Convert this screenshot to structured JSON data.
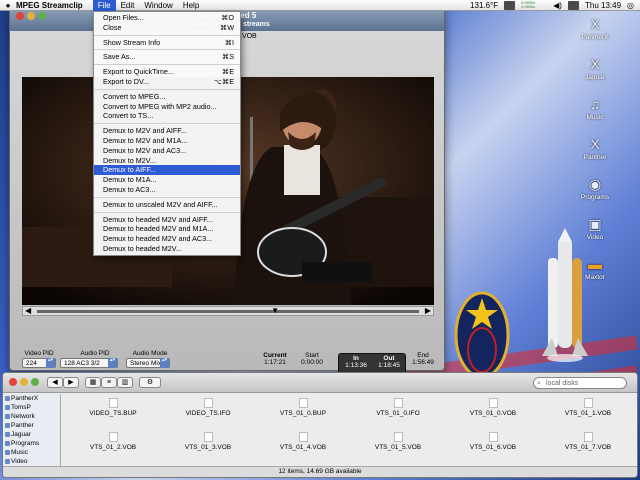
{
  "menubar": {
    "app": "MPEG Streamclip",
    "menus": [
      "File",
      "Edit",
      "Window",
      "Help"
    ],
    "temperature": "131.6°F",
    "net_up": "0.0KB/s",
    "net_down": "0.0KB/s",
    "clock": "Thu 13:49"
  },
  "file_menu": {
    "items": [
      {
        "label": "Open Files...",
        "shortcut": "⌘O"
      },
      {
        "label": "Close",
        "shortcut": "⌘W"
      },
      {
        "sep": true
      },
      {
        "label": "Show Stream Info",
        "shortcut": "⌘I"
      },
      {
        "sep": true
      },
      {
        "label": "Save As...",
        "shortcut": "⌘S"
      },
      {
        "sep": true
      },
      {
        "label": "Export to QuickTime...",
        "shortcut": "⌘E"
      },
      {
        "label": "Export to DV...",
        "shortcut": "⌥⌘E"
      },
      {
        "sep": true
      },
      {
        "label": "Convert to MPEG..."
      },
      {
        "label": "Convert to MPEG with MP2 audio..."
      },
      {
        "label": "Convert to TS..."
      },
      {
        "sep": true
      },
      {
        "label": "Demux to M2V and AIFF..."
      },
      {
        "label": "Demux to M2V and M1A..."
      },
      {
        "label": "Demux to M2V and AC3..."
      },
      {
        "label": "Demux to M2V..."
      },
      {
        "label": "Demux to AIFF...",
        "selected": true
      },
      {
        "label": "Demux to M1A..."
      },
      {
        "label": "Demux to AC3..."
      },
      {
        "sep": true
      },
      {
        "label": "Demux to unscaled M2V and AIFF..."
      },
      {
        "sep": true
      },
      {
        "label": "Demux to headed M2V and AIFF..."
      },
      {
        "label": "Demux to headed M2V and M1A..."
      },
      {
        "label": "Demux to headed M2V and AC3..."
      },
      {
        "label": "Demux to headed M2V..."
      }
    ]
  },
  "player": {
    "title": "2004 Squared 5",
    "subtitle": "les and transport streams",
    "filename": ".VOB",
    "scrub_position": 0.62,
    "video_pid_label": "Video PID",
    "video_pid": "224",
    "audio_pid_label": "Audio PID",
    "audio_pid": "128 AC3 3/2",
    "audio_mode_label": "Audio Mode",
    "audio_mode": "Stereo Mix",
    "current_label": "Current",
    "current": "1:17:21",
    "start_label": "Start",
    "start": "0:00:00",
    "in_label": "In",
    "in": "1:13:36",
    "out_label": "Out",
    "out": "1:18:45",
    "end_label": "End",
    "end": "1:56:49"
  },
  "desktop_icons": [
    {
      "label": "PantherX",
      "icon": "x-icon"
    },
    {
      "label": "Jaguar",
      "icon": "x-icon"
    },
    {
      "label": "Music",
      "icon": "music-icon"
    },
    {
      "label": "Panther",
      "icon": "x-icon"
    },
    {
      "label": "Programs",
      "icon": "globe-icon"
    },
    {
      "label": "Video",
      "icon": "clapper-icon"
    },
    {
      "label": "Maxtor",
      "icon": "drive-icon"
    }
  ],
  "finder": {
    "search_placeholder": "local disks",
    "sidebar": [
      "PantherX",
      "TomsP",
      "Network",
      "Panther",
      "Jaguar",
      "Programs",
      "Music",
      "Video"
    ],
    "files": [
      "VIDEO_TS.BUP",
      "VIDEO_TS.IFO",
      "VTS_01_0.BUP",
      "VTS_01_0.IFO",
      "VTS_01_0.VOB",
      "VTS_01_1.VOB",
      "VTS_01_2.VOB",
      "VTS_01_3.VOB",
      "VTS_01_4.VOB",
      "VTS_01_5.VOB",
      "VTS_01_6.VOB",
      "VTS_01_7.VOB"
    ],
    "status": "12 items, 14.69 GB available"
  }
}
